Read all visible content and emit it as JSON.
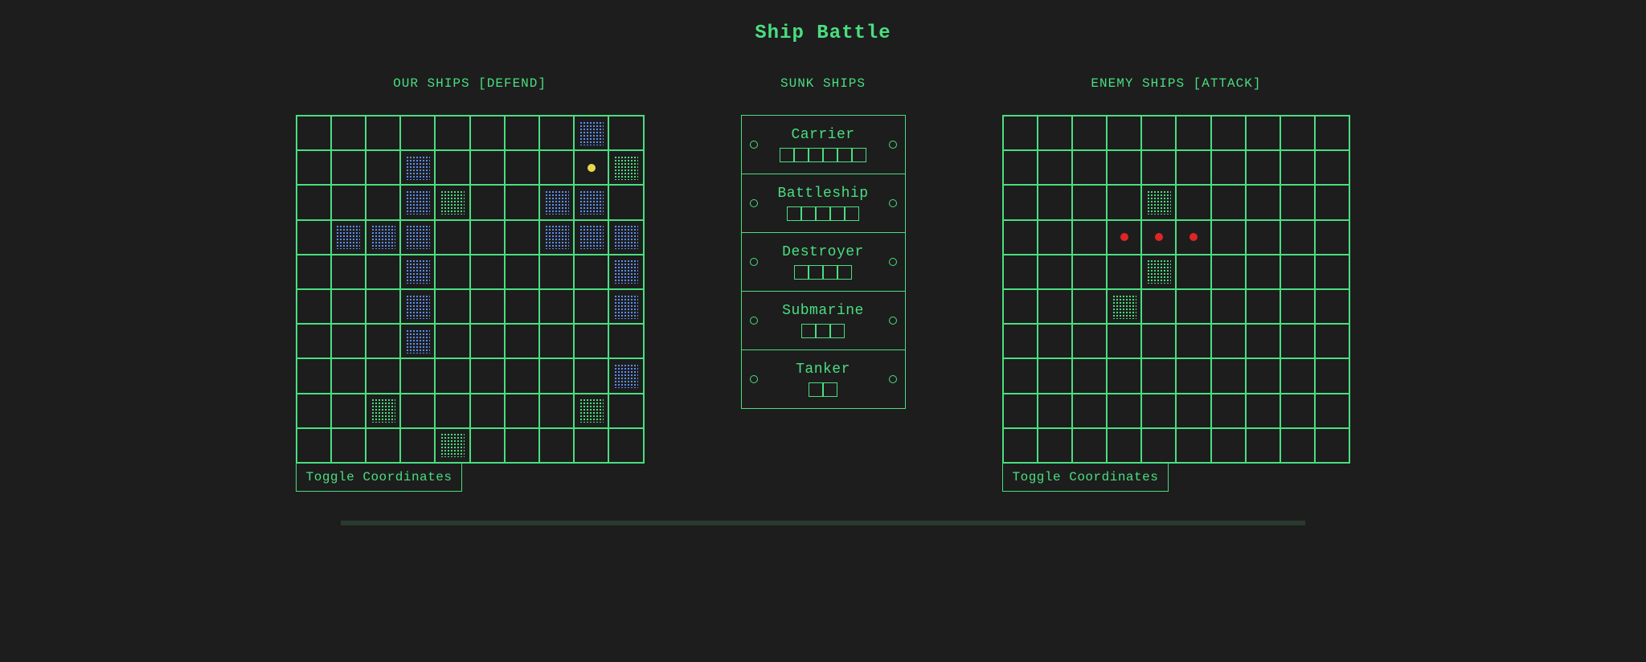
{
  "title": "Ship Battle",
  "panels": {
    "defend_title": "OUR SHIPS [DEFEND]",
    "sunk_title": "SUNK SHIPS",
    "attack_title": "ENEMY SHIPS [ATTACK]",
    "toggle_label": "Toggle Coordinates"
  },
  "sunk_ships": [
    {
      "name": "Carrier",
      "size": 6
    },
    {
      "name": "Battleship",
      "size": 5
    },
    {
      "name": "Destroyer",
      "size": 4
    },
    {
      "name": "Submarine",
      "size": 3
    },
    {
      "name": "Tanker",
      "size": 2
    }
  ],
  "defend_board": {
    "rows": 10,
    "cols": 10,
    "ships_blue": [
      [
        0,
        8
      ],
      [
        1,
        3
      ],
      [
        2,
        3
      ],
      [
        2,
        7
      ],
      [
        2,
        8
      ],
      [
        3,
        1
      ],
      [
        3,
        2
      ],
      [
        3,
        3
      ],
      [
        3,
        7
      ],
      [
        3,
        8
      ],
      [
        3,
        9
      ],
      [
        4,
        3
      ],
      [
        4,
        9
      ],
      [
        5,
        3
      ],
      [
        5,
        9
      ],
      [
        6,
        3
      ],
      [
        7,
        9
      ]
    ],
    "ships_green": [
      [
        1,
        9
      ],
      [
        2,
        4
      ],
      [
        8,
        2
      ],
      [
        8,
        8
      ],
      [
        9,
        4
      ]
    ],
    "misses_yellow": [
      [
        1,
        8
      ]
    ]
  },
  "attack_board": {
    "rows": 10,
    "cols": 10,
    "ships_green": [
      [
        2,
        4
      ],
      [
        4,
        4
      ],
      [
        5,
        3
      ]
    ],
    "misses_red": [
      [
        3,
        3
      ],
      [
        3,
        4
      ],
      [
        3,
        5
      ]
    ]
  }
}
